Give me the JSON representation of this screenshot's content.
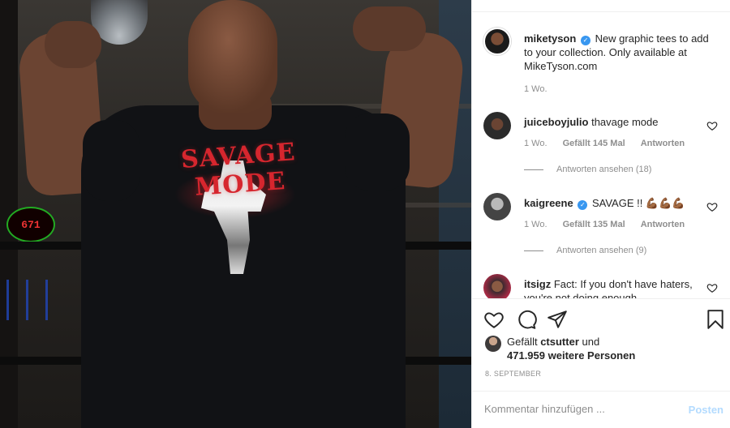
{
  "photo": {
    "shirt_text": "SAVAGE MODE",
    "scoreboard": "671"
  },
  "post": {
    "author": "miketyson",
    "caption": "New graphic tees to add to your collection. Only available at MikeTyson.com",
    "age": "1 Wo."
  },
  "comments": [
    {
      "username": "juiceboyjulio",
      "verified": false,
      "text": "thavage mode",
      "age": "1 Wo.",
      "likes": "Gefällt 145 Mal",
      "reply_label": "Antworten",
      "view_replies": "Antworten ansehen (18)"
    },
    {
      "username": "kaigreene",
      "verified": true,
      "text": "SAVAGE !! 💪🏾💪🏾💪🏾",
      "age": "1 Wo.",
      "likes": "Gefällt 135 Mal",
      "reply_label": "Antworten",
      "view_replies": "Antworten ansehen (9)"
    },
    {
      "username": "itsigz",
      "verified": false,
      "text": "Fact: If you don't have haters, you're not doing enough"
    }
  ],
  "actions": {
    "like_icon": "heart-icon",
    "comment_icon": "comment-icon",
    "share_icon": "paper-plane-icon",
    "save_icon": "bookmark-icon"
  },
  "likes": {
    "prefix": "Gefällt",
    "user": "ctsutter",
    "connector": "und",
    "count": "471.959",
    "suffix": "weitere Personen"
  },
  "date": "8. SEPTEMBER",
  "add_comment": {
    "placeholder": "Kommentar hinzufügen ...",
    "post_label": "Posten"
  },
  "colors": {
    "verified_blue": "#3897f0",
    "post_button_disabled": "#b3dbff",
    "meta_gray": "#8e8e8e",
    "shirt_red": "#d6262e"
  }
}
